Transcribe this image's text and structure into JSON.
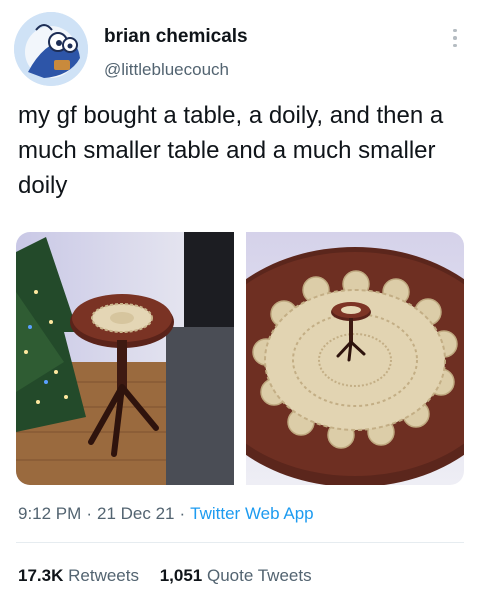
{
  "author": {
    "display_name": "brian chemicals",
    "handle": "@littlebluecouch"
  },
  "tweet": {
    "text": "my gf bought a table, a doily, and then a much smaller table and a much smaller doily",
    "time": "9:12 PM",
    "date": "21 Dec 21",
    "source": "Twitter Web App",
    "separator": "·"
  },
  "media": {
    "photos": [
      {
        "depicts": "small round wooden table with doily beside a Christmas tree"
      },
      {
        "depicts": "tiny table with tiny doily standing on a large doily"
      }
    ]
  },
  "stats": {
    "retweets_count": "17.3K",
    "retweets_label": "Retweets",
    "quotes_count": "1,051",
    "quotes_label": "Quote Tweets"
  },
  "icons": {
    "more": "more-options-icon"
  },
  "colors": {
    "link": "#1d9bf0",
    "secondary_text": "#536471",
    "primary_text": "#0f1419"
  }
}
